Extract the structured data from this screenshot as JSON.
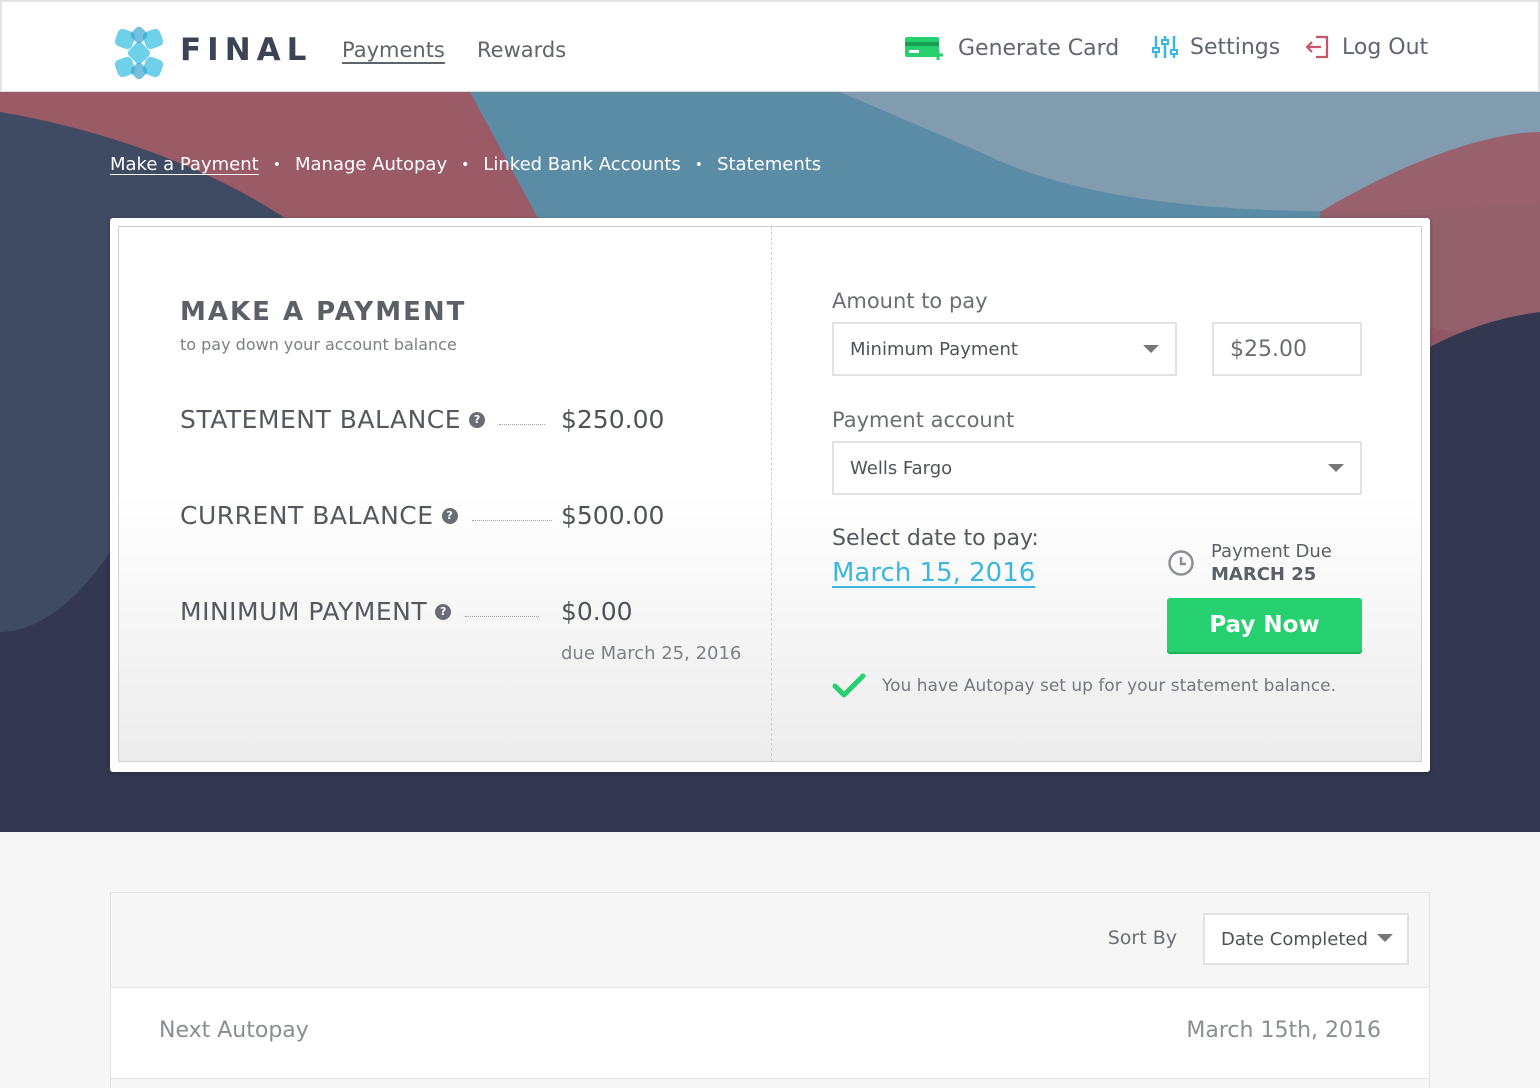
{
  "brand": {
    "name": "FINAL",
    "accent": "#3bb7e0",
    "green": "#27d06e"
  },
  "nav": {
    "left": [
      {
        "label": "Payments",
        "active": true
      },
      {
        "label": "Rewards",
        "active": false
      }
    ],
    "right": [
      {
        "label": "Generate Card",
        "icon": "credit-card-plus-icon"
      },
      {
        "label": "Settings",
        "icon": "sliders-icon"
      },
      {
        "label": "Log Out",
        "icon": "logout-icon"
      }
    ]
  },
  "breadcrumbs": [
    {
      "label": "Make a Payment",
      "active": true
    },
    {
      "label": "Manage Autopay",
      "active": false
    },
    {
      "label": "Linked Bank Accounts",
      "active": false
    },
    {
      "label": "Statements",
      "active": false
    }
  ],
  "payment": {
    "title": "MAKE A PAYMENT",
    "subtitle": "to pay down your account balance",
    "balances": [
      {
        "label": "STATEMENT BALANCE",
        "value": "$250.00"
      },
      {
        "label": "CURRENT BALANCE",
        "value": "$500.00"
      },
      {
        "label": "MINIMUM PAYMENT",
        "value": "$0.00"
      }
    ],
    "minimum_due_note": "due March 25, 2016",
    "amount_label": "Amount to pay",
    "amount_type": "Minimum Payment",
    "amount_value": "$25.00",
    "account_label": "Payment account",
    "account_value": "Wells Fargo",
    "date_label": "Select date to pay:",
    "date_value": "March 15, 2016",
    "due_label": "Payment Due",
    "due_value": "MARCH 25",
    "pay_button": "Pay Now",
    "autopay_note": "You have Autopay set up for your statement balance."
  },
  "list": {
    "sort_label": "Sort By",
    "sort_value": "Date Completed",
    "rows": [
      {
        "label": "Next Autopay",
        "date": "March 15th, 2016"
      }
    ]
  }
}
